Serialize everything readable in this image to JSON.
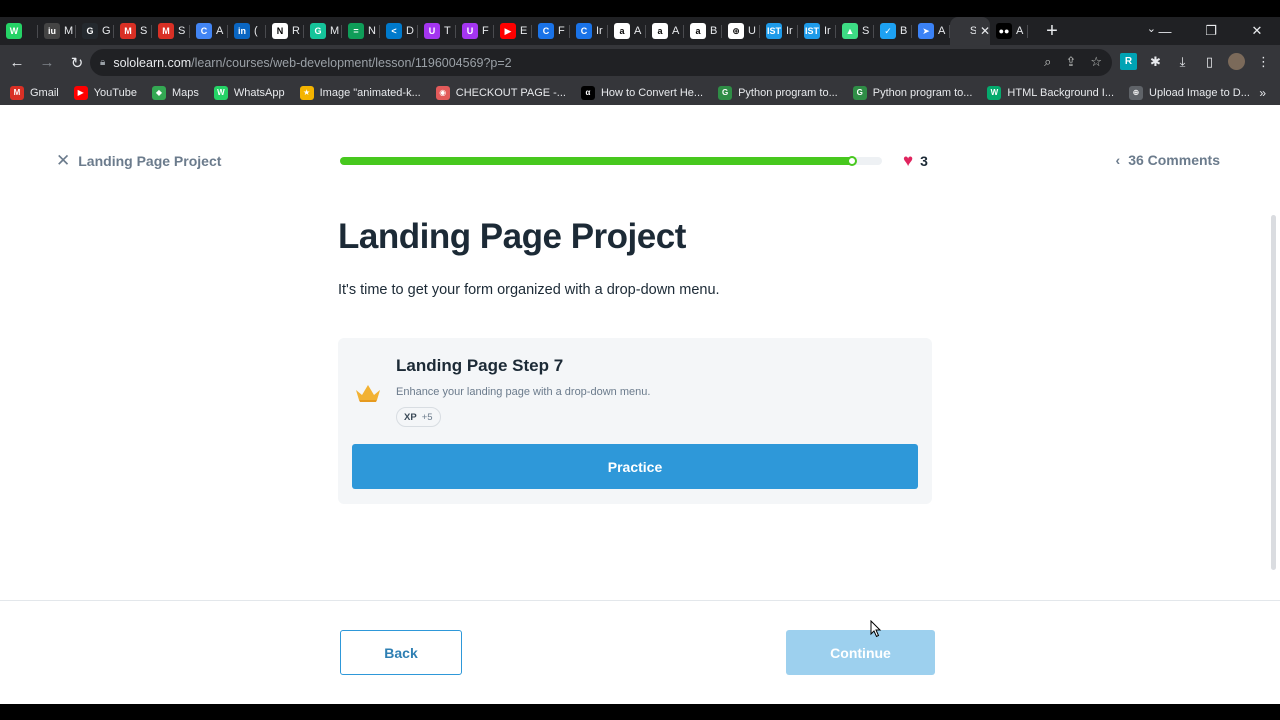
{
  "browser": {
    "tabs": [
      {
        "icon": "whatsapp-icon",
        "color": "#25d366",
        "glyph": "W",
        "label": ""
      },
      {
        "icon": "iu-icon",
        "color": "#444444",
        "glyph": "iu",
        "label": "M"
      },
      {
        "icon": "github-icon",
        "color": "#24292e",
        "glyph": "G",
        "label": "G"
      },
      {
        "icon": "gmail-icon",
        "color": "#d93025",
        "glyph": "M",
        "label": "S"
      },
      {
        "icon": "gmail-icon",
        "color": "#d93025",
        "glyph": "M",
        "label": "S"
      },
      {
        "icon": "crescent-icon",
        "color": "#4285f4",
        "glyph": "C",
        "label": "A"
      },
      {
        "icon": "linkedin-icon",
        "color": "#0a66c2",
        "glyph": "in",
        "label": "("
      },
      {
        "icon": "notion-icon",
        "color": "#ffffff",
        "glyph": "N",
        "label": "R"
      },
      {
        "icon": "grammarly-icon",
        "color": "#15c39a",
        "glyph": "G",
        "label": "M"
      },
      {
        "icon": "toggle-icon",
        "color": "#0f9d58",
        "glyph": "=",
        "label": "N"
      },
      {
        "icon": "vscode-icon",
        "color": "#007acc",
        "glyph": "<",
        "label": "D"
      },
      {
        "icon": "udemy-icon",
        "color": "#a435f0",
        "glyph": "U",
        "label": "T"
      },
      {
        "icon": "udemy-icon",
        "color": "#a435f0",
        "glyph": "U",
        "label": "F"
      },
      {
        "icon": "youtube-icon",
        "color": "#ff0000",
        "glyph": "▶",
        "label": "E"
      },
      {
        "icon": "c-icon",
        "color": "#1a73e8",
        "glyph": "C",
        "label": "F"
      },
      {
        "icon": "c-icon",
        "color": "#1a73e8",
        "glyph": "C",
        "label": "Ir"
      },
      {
        "icon": "amazon-icon",
        "color": "#ffffff",
        "glyph": "a",
        "label": "A"
      },
      {
        "icon": "amazon-icon",
        "color": "#ffffff",
        "glyph": "a",
        "label": "A"
      },
      {
        "icon": "amazon-icon",
        "color": "#ffffff",
        "glyph": "a",
        "label": "B"
      },
      {
        "icon": "globe-icon",
        "color": "#ffffff",
        "glyph": "⊕",
        "label": "U"
      },
      {
        "icon": "ist-icon",
        "color": "#1e9be9",
        "glyph": "IST",
        "label": "Ir"
      },
      {
        "icon": "ist-icon",
        "color": "#1e9be9",
        "glyph": "IST",
        "label": "Ir"
      },
      {
        "icon": "android-icon",
        "color": "#3ddc84",
        "glyph": "▲",
        "label": "S"
      },
      {
        "icon": "bird-icon",
        "color": "#1da1f2",
        "glyph": "✓",
        "label": "B"
      },
      {
        "icon": "send-icon",
        "color": "#3b82f6",
        "glyph": "➤",
        "label": "A"
      }
    ],
    "active_tab": {
      "icon": "sololearn-icon",
      "label": "So"
    },
    "after_tabs": [
      {
        "icon": "medium-icon",
        "color": "#000000",
        "glyph": "●●",
        "label": "A"
      }
    ],
    "url_host": "sololearn.com",
    "url_path": "/learn/courses/web-development/lesson/1196004569?p=2",
    "bookmarks": [
      {
        "label": "Gmail",
        "icon": "gmail-icon",
        "color": "#d93025",
        "glyph": "M"
      },
      {
        "label": "YouTube",
        "icon": "youtube-icon",
        "color": "#ff0000",
        "glyph": "▶"
      },
      {
        "label": "Maps",
        "icon": "maps-icon",
        "color": "#34a853",
        "glyph": "◆"
      },
      {
        "label": "WhatsApp",
        "icon": "whatsapp-icon",
        "color": "#25d366",
        "glyph": "W"
      },
      {
        "label": "Image \"animated-k...",
        "icon": "star-icon",
        "color": "#f4b400",
        "glyph": "★"
      },
      {
        "label": "CHECKOUT PAGE -...",
        "icon": "codepen-icon",
        "color": "#e25a5a",
        "glyph": "◉"
      },
      {
        "label": "How to Convert He...",
        "icon": "alpha-icon",
        "color": "#000000",
        "glyph": "α"
      },
      {
        "label": "Python program to...",
        "icon": "gfg-icon",
        "color": "#2f8d46",
        "glyph": "G"
      },
      {
        "label": "Python program to...",
        "icon": "gfg-icon",
        "color": "#2f8d46",
        "glyph": "G"
      },
      {
        "label": "HTML Background I...",
        "icon": "w3-icon",
        "color": "#04aa6d",
        "glyph": "W"
      },
      {
        "label": "Upload Image to D...",
        "icon": "globe-icon",
        "color": "#5f6368",
        "glyph": "⊕"
      }
    ]
  },
  "header": {
    "close_label": "Landing Page Project",
    "progress": 0.95,
    "hearts": "3",
    "comments_label": "36 Comments"
  },
  "lesson": {
    "title": "Landing Page Project",
    "description": "It's time to get your form organized with a drop-down menu."
  },
  "card": {
    "title": "Landing Page Step 7",
    "subtitle": "Enhance your landing page with a drop-down menu.",
    "xp_label": "XP",
    "xp_value": "+5",
    "button_label": "Practice"
  },
  "footer": {
    "back_label": "Back",
    "continue_label": "Continue"
  },
  "colors": {
    "accent": "#2e98d9",
    "progress": "#47c81e",
    "heart": "#e0245e",
    "continue_disabled": "#9dd0ee"
  }
}
